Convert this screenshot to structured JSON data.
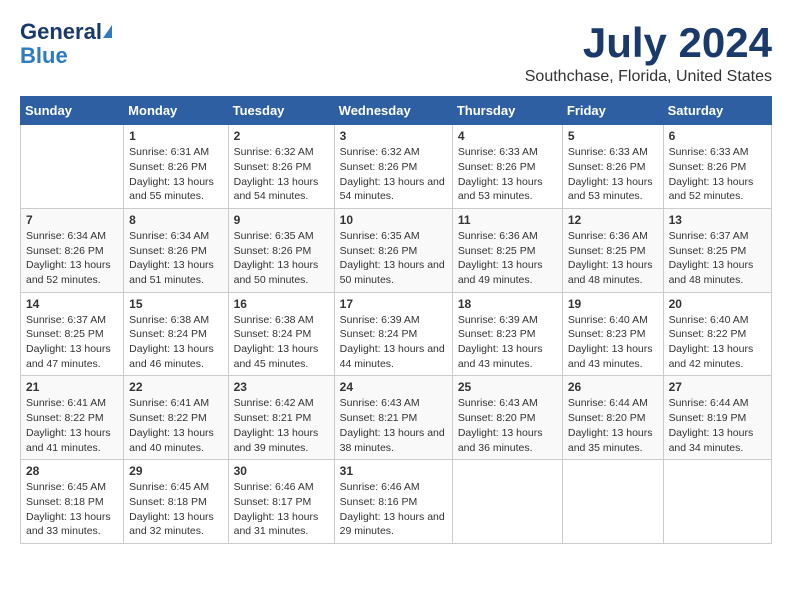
{
  "header": {
    "logo_general": "General",
    "logo_blue": "Blue",
    "title": "July 2024",
    "subtitle": "Southchase, Florida, United States"
  },
  "calendar": {
    "headers": [
      "Sunday",
      "Monday",
      "Tuesday",
      "Wednesday",
      "Thursday",
      "Friday",
      "Saturday"
    ],
    "weeks": [
      [
        {
          "day": "",
          "sunrise": "",
          "sunset": "",
          "daylight": ""
        },
        {
          "day": "1",
          "sunrise": "Sunrise: 6:31 AM",
          "sunset": "Sunset: 8:26 PM",
          "daylight": "Daylight: 13 hours and 55 minutes."
        },
        {
          "day": "2",
          "sunrise": "Sunrise: 6:32 AM",
          "sunset": "Sunset: 8:26 PM",
          "daylight": "Daylight: 13 hours and 54 minutes."
        },
        {
          "day": "3",
          "sunrise": "Sunrise: 6:32 AM",
          "sunset": "Sunset: 8:26 PM",
          "daylight": "Daylight: 13 hours and 54 minutes."
        },
        {
          "day": "4",
          "sunrise": "Sunrise: 6:33 AM",
          "sunset": "Sunset: 8:26 PM",
          "daylight": "Daylight: 13 hours and 53 minutes."
        },
        {
          "day": "5",
          "sunrise": "Sunrise: 6:33 AM",
          "sunset": "Sunset: 8:26 PM",
          "daylight": "Daylight: 13 hours and 53 minutes."
        },
        {
          "day": "6",
          "sunrise": "Sunrise: 6:33 AM",
          "sunset": "Sunset: 8:26 PM",
          "daylight": "Daylight: 13 hours and 52 minutes."
        }
      ],
      [
        {
          "day": "7",
          "sunrise": "Sunrise: 6:34 AM",
          "sunset": "Sunset: 8:26 PM",
          "daylight": "Daylight: 13 hours and 52 minutes."
        },
        {
          "day": "8",
          "sunrise": "Sunrise: 6:34 AM",
          "sunset": "Sunset: 8:26 PM",
          "daylight": "Daylight: 13 hours and 51 minutes."
        },
        {
          "day": "9",
          "sunrise": "Sunrise: 6:35 AM",
          "sunset": "Sunset: 8:26 PM",
          "daylight": "Daylight: 13 hours and 50 minutes."
        },
        {
          "day": "10",
          "sunrise": "Sunrise: 6:35 AM",
          "sunset": "Sunset: 8:26 PM",
          "daylight": "Daylight: 13 hours and 50 minutes."
        },
        {
          "day": "11",
          "sunrise": "Sunrise: 6:36 AM",
          "sunset": "Sunset: 8:25 PM",
          "daylight": "Daylight: 13 hours and 49 minutes."
        },
        {
          "day": "12",
          "sunrise": "Sunrise: 6:36 AM",
          "sunset": "Sunset: 8:25 PM",
          "daylight": "Daylight: 13 hours and 48 minutes."
        },
        {
          "day": "13",
          "sunrise": "Sunrise: 6:37 AM",
          "sunset": "Sunset: 8:25 PM",
          "daylight": "Daylight: 13 hours and 48 minutes."
        }
      ],
      [
        {
          "day": "14",
          "sunrise": "Sunrise: 6:37 AM",
          "sunset": "Sunset: 8:25 PM",
          "daylight": "Daylight: 13 hours and 47 minutes."
        },
        {
          "day": "15",
          "sunrise": "Sunrise: 6:38 AM",
          "sunset": "Sunset: 8:24 PM",
          "daylight": "Daylight: 13 hours and 46 minutes."
        },
        {
          "day": "16",
          "sunrise": "Sunrise: 6:38 AM",
          "sunset": "Sunset: 8:24 PM",
          "daylight": "Daylight: 13 hours and 45 minutes."
        },
        {
          "day": "17",
          "sunrise": "Sunrise: 6:39 AM",
          "sunset": "Sunset: 8:24 PM",
          "daylight": "Daylight: 13 hours and 44 minutes."
        },
        {
          "day": "18",
          "sunrise": "Sunrise: 6:39 AM",
          "sunset": "Sunset: 8:23 PM",
          "daylight": "Daylight: 13 hours and 43 minutes."
        },
        {
          "day": "19",
          "sunrise": "Sunrise: 6:40 AM",
          "sunset": "Sunset: 8:23 PM",
          "daylight": "Daylight: 13 hours and 43 minutes."
        },
        {
          "day": "20",
          "sunrise": "Sunrise: 6:40 AM",
          "sunset": "Sunset: 8:22 PM",
          "daylight": "Daylight: 13 hours and 42 minutes."
        }
      ],
      [
        {
          "day": "21",
          "sunrise": "Sunrise: 6:41 AM",
          "sunset": "Sunset: 8:22 PM",
          "daylight": "Daylight: 13 hours and 41 minutes."
        },
        {
          "day": "22",
          "sunrise": "Sunrise: 6:41 AM",
          "sunset": "Sunset: 8:22 PM",
          "daylight": "Daylight: 13 hours and 40 minutes."
        },
        {
          "day": "23",
          "sunrise": "Sunrise: 6:42 AM",
          "sunset": "Sunset: 8:21 PM",
          "daylight": "Daylight: 13 hours and 39 minutes."
        },
        {
          "day": "24",
          "sunrise": "Sunrise: 6:43 AM",
          "sunset": "Sunset: 8:21 PM",
          "daylight": "Daylight: 13 hours and 38 minutes."
        },
        {
          "day": "25",
          "sunrise": "Sunrise: 6:43 AM",
          "sunset": "Sunset: 8:20 PM",
          "daylight": "Daylight: 13 hours and 36 minutes."
        },
        {
          "day": "26",
          "sunrise": "Sunrise: 6:44 AM",
          "sunset": "Sunset: 8:20 PM",
          "daylight": "Daylight: 13 hours and 35 minutes."
        },
        {
          "day": "27",
          "sunrise": "Sunrise: 6:44 AM",
          "sunset": "Sunset: 8:19 PM",
          "daylight": "Daylight: 13 hours and 34 minutes."
        }
      ],
      [
        {
          "day": "28",
          "sunrise": "Sunrise: 6:45 AM",
          "sunset": "Sunset: 8:18 PM",
          "daylight": "Daylight: 13 hours and 33 minutes."
        },
        {
          "day": "29",
          "sunrise": "Sunrise: 6:45 AM",
          "sunset": "Sunset: 8:18 PM",
          "daylight": "Daylight: 13 hours and 32 minutes."
        },
        {
          "day": "30",
          "sunrise": "Sunrise: 6:46 AM",
          "sunset": "Sunset: 8:17 PM",
          "daylight": "Daylight: 13 hours and 31 minutes."
        },
        {
          "day": "31",
          "sunrise": "Sunrise: 6:46 AM",
          "sunset": "Sunset: 8:16 PM",
          "daylight": "Daylight: 13 hours and 29 minutes."
        },
        {
          "day": "",
          "sunrise": "",
          "sunset": "",
          "daylight": ""
        },
        {
          "day": "",
          "sunrise": "",
          "sunset": "",
          "daylight": ""
        },
        {
          "day": "",
          "sunrise": "",
          "sunset": "",
          "daylight": ""
        }
      ]
    ]
  }
}
